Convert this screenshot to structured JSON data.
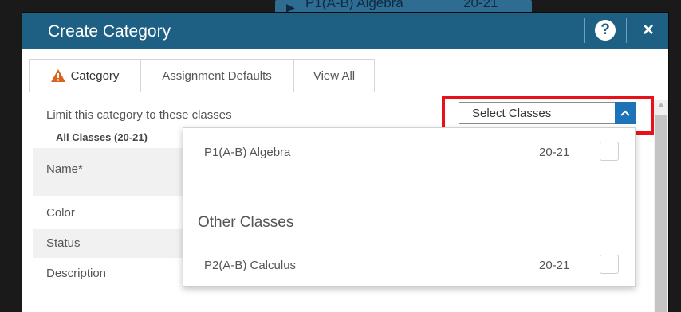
{
  "background": {
    "class_title": "P1(A-B) Algebra",
    "class_year": "20-21"
  },
  "modal": {
    "title": "Create Category",
    "help_label": "?",
    "close_label": "×"
  },
  "tabs": [
    {
      "label": "Category",
      "active": true,
      "icon": "warning-icon"
    },
    {
      "label": "Assignment Defaults",
      "active": false
    },
    {
      "label": "View All",
      "active": false
    }
  ],
  "form": {
    "limit_label": "Limit this category to these classes",
    "all_classes": "All Classes  (20-21)",
    "name_label": "Name*",
    "color_label": "Color",
    "status_label": "Status",
    "description_label": "Description"
  },
  "select_classes": {
    "value": "Select Classes",
    "caret_icon": "chevron-up-icon"
  },
  "dropdown": {
    "my_classes": [
      {
        "name": "P1(A-B) Algebra",
        "year": "20-21",
        "checked": false
      }
    ],
    "group_label": "Other Classes",
    "other_classes": [
      {
        "name": "P2(A-B) Calculus",
        "year": "20-21",
        "checked": false
      }
    ]
  },
  "colors": {
    "header": "#1e5f84",
    "accent": "#1e72b8",
    "highlight": "#e8111a",
    "warning": "#d9631e"
  }
}
